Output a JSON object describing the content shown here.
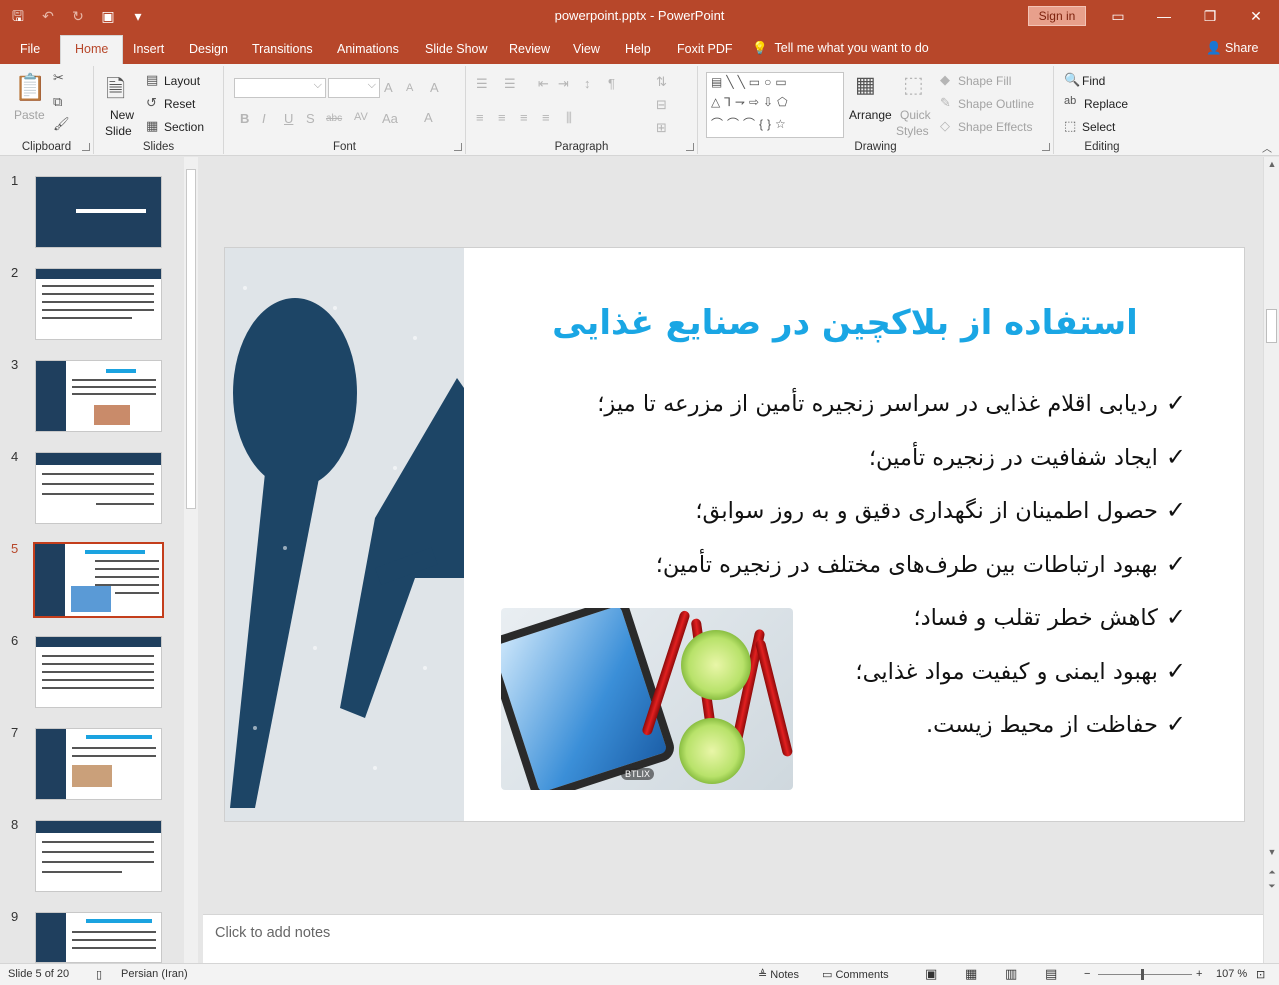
{
  "window": {
    "title": "powerpoint.pptx  -  PowerPoint",
    "signin_label": "Sign in"
  },
  "tabs": [
    "File",
    "Home",
    "Insert",
    "Design",
    "Transitions",
    "Animations",
    "Slide Show",
    "Review",
    "View",
    "Help",
    "Foxit PDF"
  ],
  "active_tab": "Home",
  "tellme": "Tell me what you want to do",
  "share_label": "Share",
  "ribbon": {
    "clipboard": {
      "label": "Clipboard",
      "paste": "Paste"
    },
    "slides": {
      "label": "Slides",
      "new_slide": "New",
      "new_slide2": "Slide",
      "layout": "Layout",
      "reset": "Reset",
      "section": "Section"
    },
    "font": {
      "label": "Font"
    },
    "paragraph": {
      "label": "Paragraph"
    },
    "drawing": {
      "label": "Drawing",
      "arrange": "Arrange",
      "quick_styles": "Quick",
      "quick_styles2": "Styles",
      "shape_fill": "Shape Fill",
      "shape_outline": "Shape Outline",
      "shape_effects": "Shape Effects"
    },
    "editing": {
      "label": "Editing",
      "find": "Find",
      "replace": "Replace",
      "select": "Select"
    }
  },
  "thumbnails": [
    "1",
    "2",
    "3",
    "4",
    "5",
    "6",
    "7",
    "8",
    "9"
  ],
  "active_slide": 5,
  "slide": {
    "title": "استفاده از بلاکچین در صنایع غذایی",
    "bullets": [
      "ردیابی اقلام غذایی در سراسر زنجیره تأمین از مزرعه تا میز؛",
      "ایجاد شفافیت در زنجیره تأمین؛",
      "حصول اطمینان از نگهداری دقیق و به روز سوابق؛",
      "بهبود ارتباطات بین طرف‌های مختلف در زنجیره تأمین؛",
      "کاهش خطر تقلب و فساد؛",
      "بهبود ایمنی و کیفیت مواد غذایی؛",
      "حفاظت از محیط زیست."
    ],
    "check_glyph": "✓",
    "watermark": "BTLIX"
  },
  "notes_placeholder": "Click to add notes",
  "status": {
    "slide_info": "Slide 5 of 20",
    "language": "Persian (Iran)",
    "notes": "Notes",
    "comments": "Comments",
    "zoom": "107 %"
  },
  "colors": {
    "accent": "#b7472a",
    "title_blue": "#1aa6e4"
  }
}
